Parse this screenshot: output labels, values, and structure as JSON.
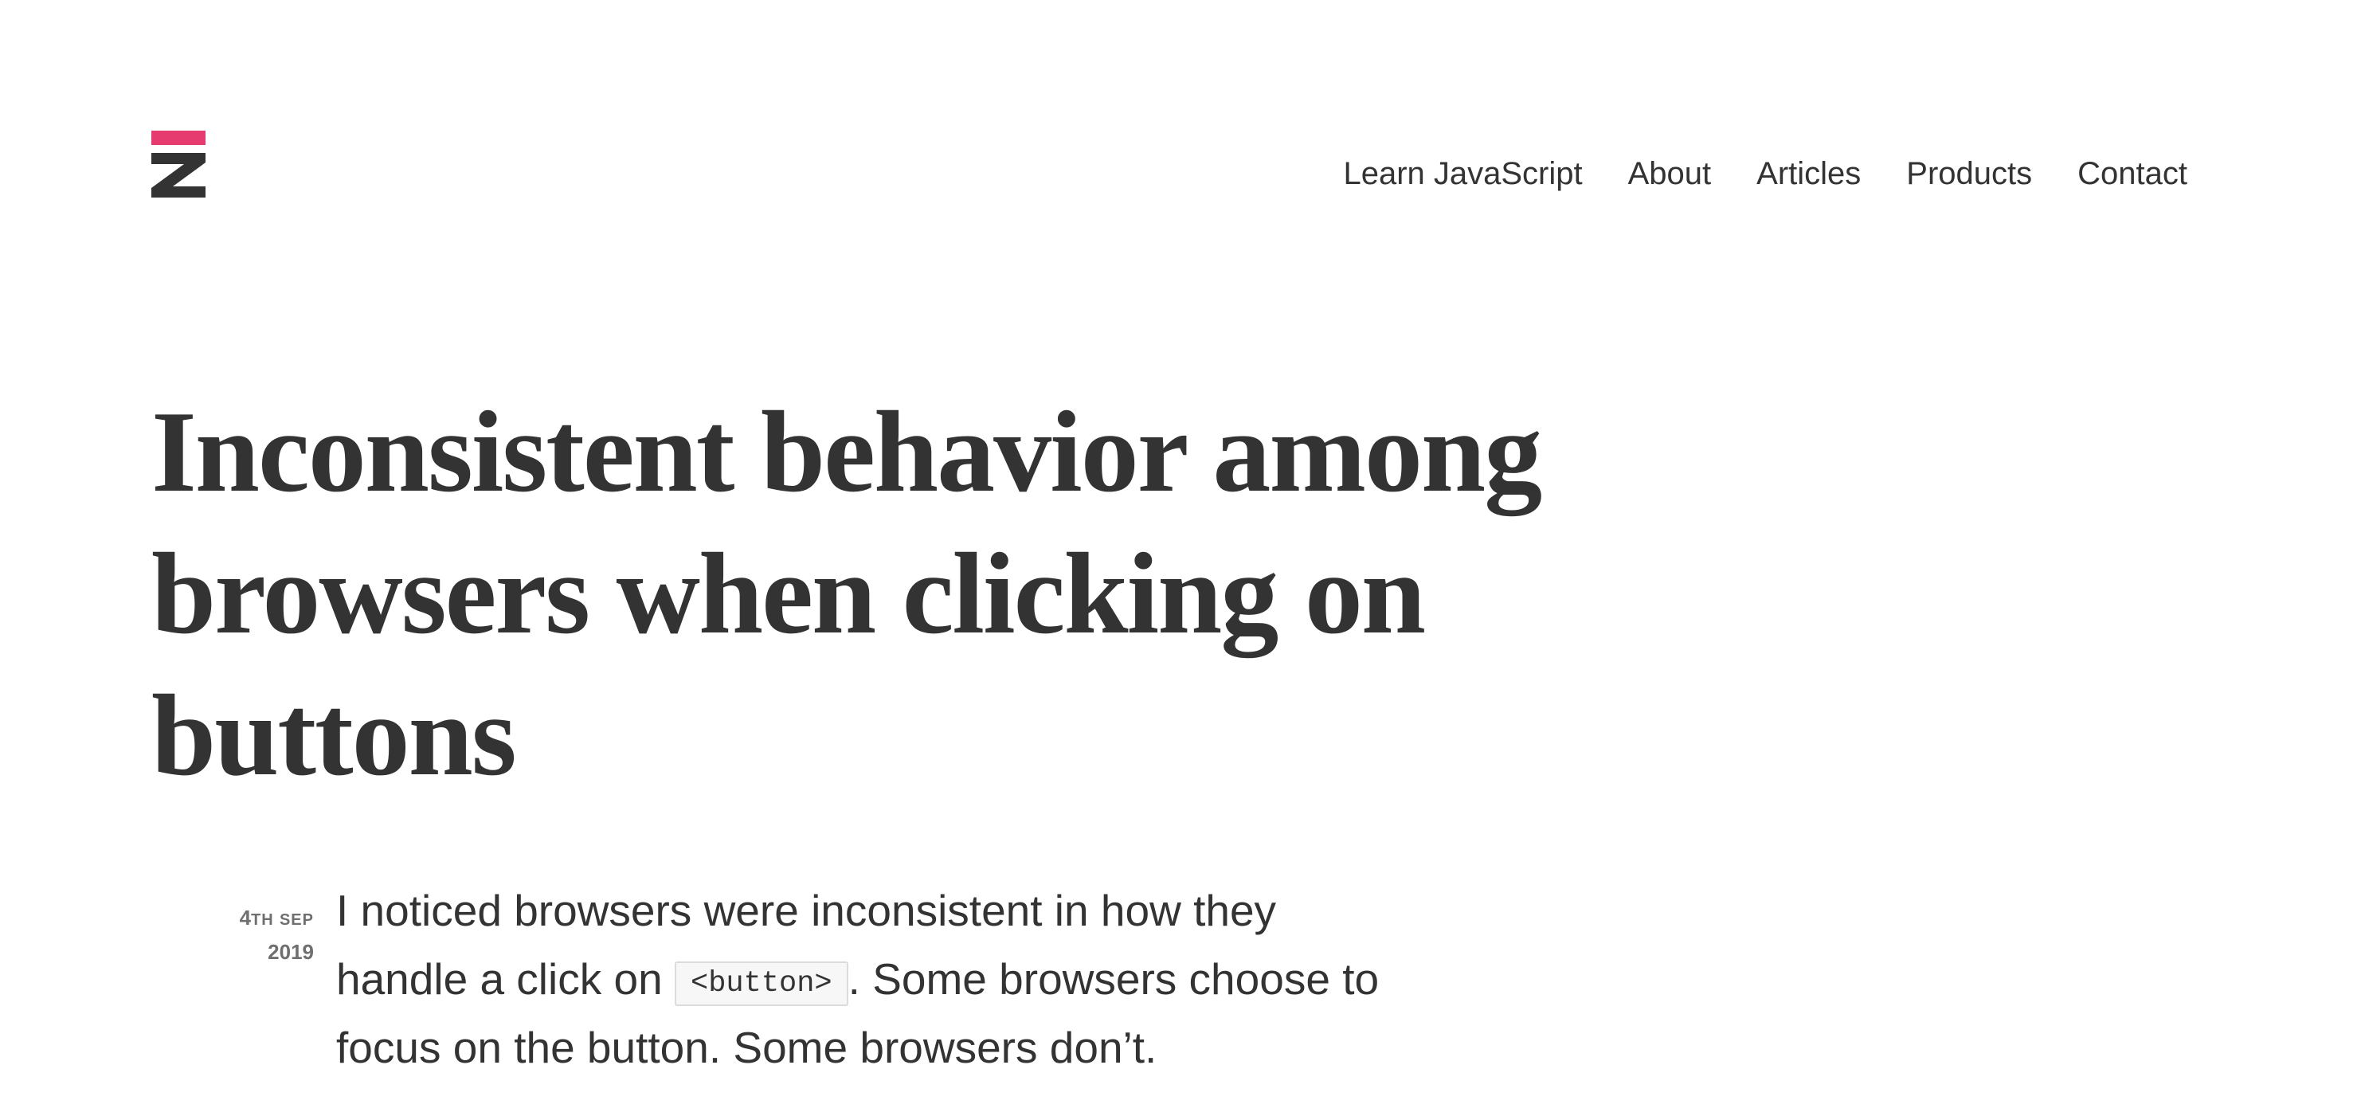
{
  "brand": {
    "logo_label": "Z",
    "logo_accent_color": "#e63b6f",
    "logo_dark_color": "#333333"
  },
  "nav": {
    "items": [
      {
        "label": "Learn JavaScript"
      },
      {
        "label": "About"
      },
      {
        "label": "Articles"
      },
      {
        "label": "Products"
      },
      {
        "label": "Contact"
      }
    ]
  },
  "article": {
    "title": "Inconsistent behavior among browsers when clicking on buttons",
    "date": {
      "day": "4",
      "suffix": "TH",
      "month": "SEP",
      "year": "2019"
    },
    "intro": {
      "before_code": "I noticed browsers were inconsistent in how they handle a click on ",
      "code": "<button>",
      "after_code": ". Some browsers choose to focus on the button. Some browsers don’t."
    }
  },
  "colors": {
    "text": "#333333",
    "muted": "#6f6f6f",
    "accent": "#e63b6f",
    "background": "#ffffff"
  }
}
